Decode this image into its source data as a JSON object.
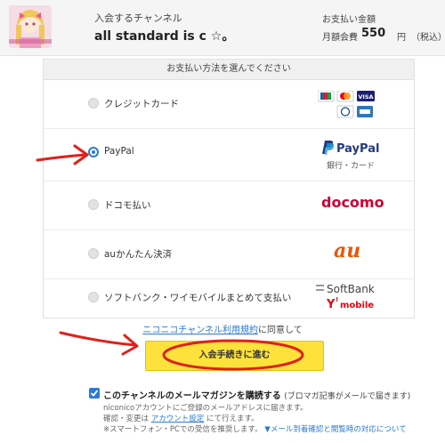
{
  "header": {
    "channel_label": "入会するチャンネル",
    "channel_name": "all standard is  c ☆。",
    "payment_label": "お支払い金額",
    "plan": "月額会費",
    "price": "550",
    "yen": "円",
    "tax": "（税込）"
  },
  "methods": {
    "title": "お支払い方法を選んでください",
    "items": [
      {
        "label": "クレジットカード",
        "selected": false,
        "logo": "credit-card-brands"
      },
      {
        "label": "PayPal",
        "selected": true,
        "logo": "paypal",
        "logo_text": "PayPal",
        "logo_sub": "銀行・カード"
      },
      {
        "label": "ドコモ払い",
        "selected": false,
        "logo": "docomo",
        "logo_text": "docomo"
      },
      {
        "label": "auかんたん決済",
        "selected": false,
        "logo": "au",
        "logo_text": "au"
      },
      {
        "label": "ソフトバンク・ワイモバイルまとめて支払い",
        "selected": false,
        "logo": "softbank-ymobile",
        "logo_text": "SoftBank",
        "logo_text2": "mobile"
      }
    ]
  },
  "terms": {
    "link": "ニコニコチャンネル利用規約",
    "suffix": "に同意して"
  },
  "join_button": "入会手続きに進む",
  "newsletter": {
    "title": "このチャンネルのメールマガジンを購読する",
    "note": "(ブロマガ記事がメールで届きます)",
    "line1": "niconicoアカウントにご登録のメールアドレスに届きます。",
    "line2_a": "確認・変更は",
    "line2_link": "アカウント設定",
    "line2_b": "にて行えます。",
    "line3_a": "※スマートフォン・PCでの受信を推奨します。",
    "line3_link": "▼メール到着確認と閲覧時の対応について"
  },
  "colors": {
    "accent": "#2a7ad5",
    "button": "#fde23c",
    "annotation": "#e0201b"
  }
}
